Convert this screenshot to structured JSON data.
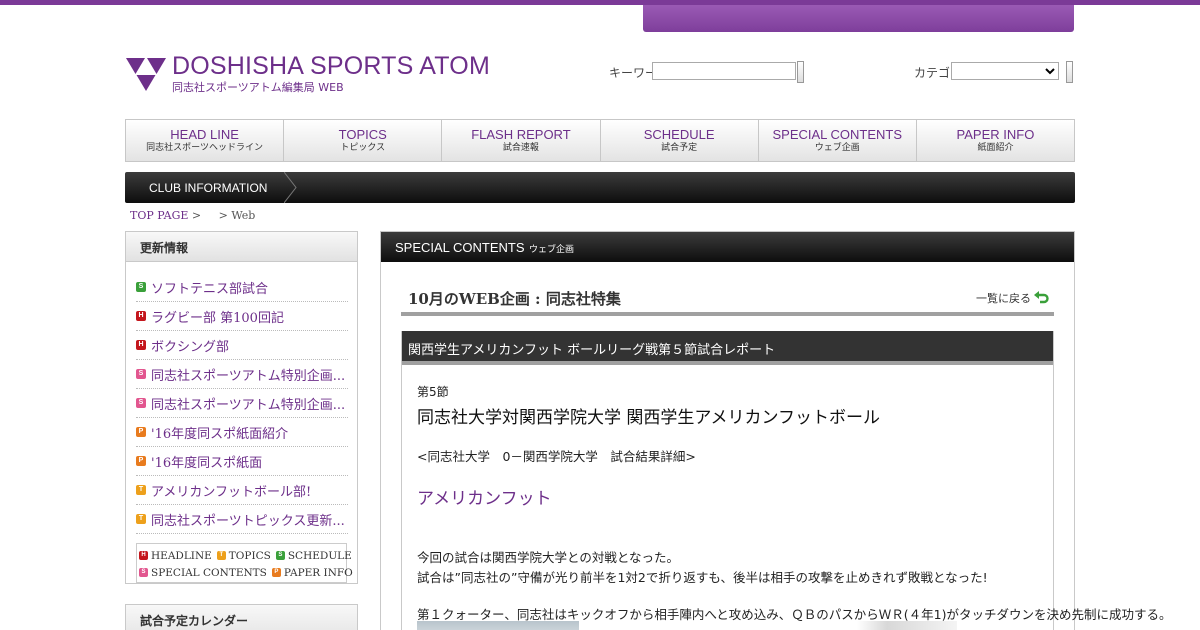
{
  "site": {
    "title": "DOSHISHA SPORTS ATOM",
    "subtitle": "同志社スポーツアトム編集局 WEB"
  },
  "search": {
    "keyword_label": "キーワード",
    "keyword_value": "",
    "category_label": "カテゴリ",
    "category_selected": ""
  },
  "gnav": [
    {
      "en": "HEAD LINE",
      "ja": "同志社スポーツヘッドライン"
    },
    {
      "en": "TOPICS",
      "ja": "トピックス"
    },
    {
      "en": "FLASH REPORT",
      "ja": "試合速報"
    },
    {
      "en": "SCHEDULE",
      "ja": "試合予定"
    },
    {
      "en": "SPECIAL CONTENTS",
      "ja": "ウェブ企画"
    },
    {
      "en": "PAPER INFO",
      "ja": "紙面紹介"
    }
  ],
  "clubbar": {
    "label": "CLUB INFORMATION"
  },
  "breadcrumb": {
    "top": "TOP PAGE",
    "sep": ">",
    "current": "> Web"
  },
  "sidebar": {
    "title": "更新情報",
    "items": [
      {
        "badge": "G",
        "badge_label": "S",
        "text": "ソフトテニス部試合"
      },
      {
        "badge": "H",
        "badge_label": "H",
        "text": "ラグビー部 第100回記"
      },
      {
        "badge": "H",
        "badge_label": "H",
        "text": "ボクシング部"
      },
      {
        "badge": "S",
        "badge_label": "S",
        "text": "同志社スポーツアトム特別企画..."
      },
      {
        "badge": "S",
        "badge_label": "S",
        "text": "同志社スポーツアトム特別企画..."
      },
      {
        "badge": "P",
        "badge_label": "P",
        "text": "'16年度同スポ紙面紹介"
      },
      {
        "badge": "P",
        "badge_label": "P",
        "text": "'16年度同スポ紙面"
      },
      {
        "badge": "T",
        "badge_label": "T",
        "text": "アメリカンフットボール部!"
      },
      {
        "badge": "T",
        "badge_label": "T",
        "text": "同志社スポーツトピックス更新..."
      }
    ],
    "legend": [
      {
        "badge": "H",
        "label": "HEADLINE"
      },
      {
        "badge": "T",
        "label": "TOPICS"
      },
      {
        "badge": "G",
        "badge_label": "S",
        "label": "SCHEDULE"
      },
      {
        "badge": "S",
        "label": "SPECIAL CONTENTS"
      },
      {
        "badge": "P",
        "label": "PAPER INFO"
      }
    ],
    "calendar_title": "試合予定カレンダー"
  },
  "main": {
    "section_en": "SPECIAL CONTENTS",
    "section_ja": "ウェブ企画",
    "page_title": "10月のWEB企画 : 同志社特集",
    "back_label": "一覧に戻る",
    "article_bar": "関西学生アメリカンフット ボールリーグ戦第５節試合レポート",
    "round": "第5節",
    "article_title": "同志社大学対関西学院大学 関西学生アメリカンフットボール",
    "score": "<同志社大学　0－関西学院大学　試合結果詳細>",
    "purple_heading": "アメリカンフット",
    "paragraph1": "今回の試合は関西学院大学との対戦となった。",
    "paragraph2": "試合は”同志社の”守備が光り前半を1対2で折り返すも、後半は相手の攻撃を止めきれず敗戦となった!",
    "paragraph3": "第１クォーター、同志社はキックオフから相手陣内へと攻め込み、ＱＢのパスからＷＲ(４年1)がタッチダウンを決め先制に成功する。"
  }
}
